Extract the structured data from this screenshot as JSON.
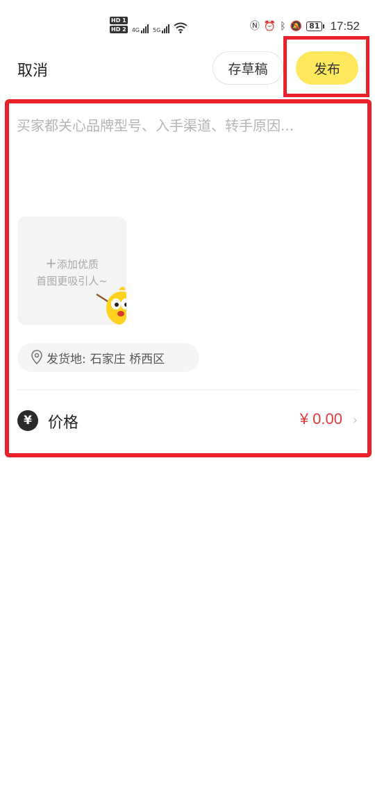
{
  "status_bar": {
    "sim1": "HD 1",
    "sim2": "HD 2",
    "net1": "4G",
    "net2": "5G",
    "battery": "81",
    "time": "17:52",
    "icons": [
      "nfc-icon",
      "alarm-icon",
      "bluetooth-icon",
      "bell-off-icon"
    ]
  },
  "header": {
    "cancel_label": "取消",
    "draft_label": "存草稿",
    "publish_label": "发布"
  },
  "form": {
    "description_placeholder": "买家都关心品牌型号、入手渠道、转手原因...",
    "photo_line1": "添加优质",
    "photo_line2": "首图更吸引人~",
    "location_label": "发货地:",
    "location_value": "石家庄 桥西区",
    "price_label": "价格",
    "price_value": "¥ 0.00"
  },
  "colors": {
    "accent_yellow": "#ffe85c",
    "price_red": "#e4393c",
    "highlight_red": "#e8202a"
  }
}
